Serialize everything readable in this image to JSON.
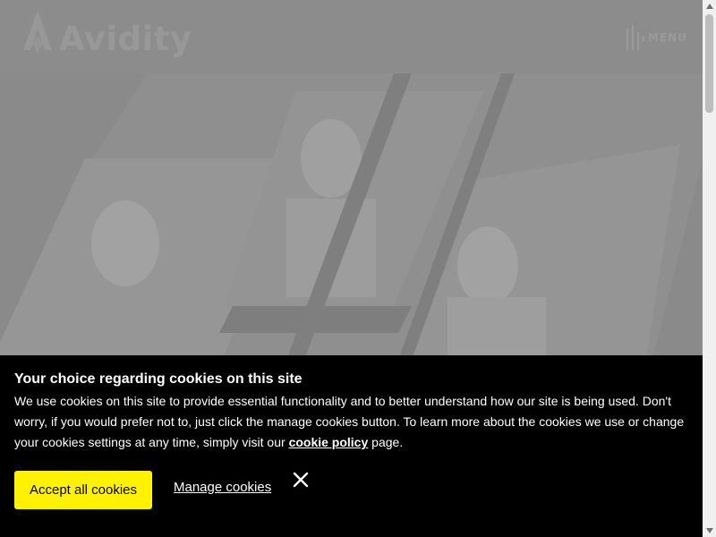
{
  "header": {
    "logo_text": "Avidity",
    "menu_label": "MENU"
  },
  "cookie_banner": {
    "title": "Your choice regarding cookies on this site",
    "body_text": "We use cookies on this site to provide essential functionality and to better understand how our site is being used. Don't worry, if you would prefer not to, just click the manage cookies button. To learn more about the cookies we use or change your cookies settings at any time, simply visit our",
    "link_text": "cookie policy",
    "body_suffix": "page.",
    "accept_label": "Accept all cookies",
    "manage_label": "Manage cookies"
  },
  "colors": {
    "accent": "#fff200",
    "banner_bg": "#000000",
    "overlay": "#8a8a8a"
  },
  "icons": {
    "logo": "avidity-logo-icon",
    "menu": "menu-bars-icon",
    "close": "close-icon"
  }
}
